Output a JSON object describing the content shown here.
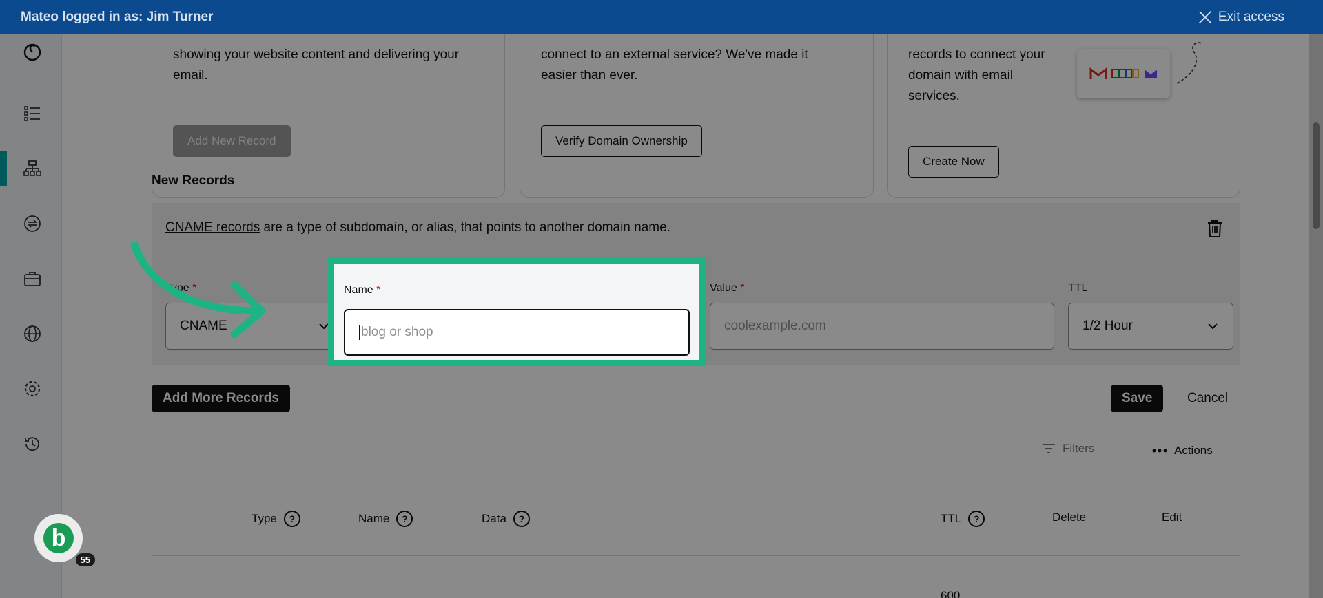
{
  "topbar": {
    "logged_in_text": "Mateo logged in as: Jim Turner",
    "exit_label": "Exit access"
  },
  "cards": [
    {
      "text": "showing your website content and delivering your email.",
      "button": "Add New Record"
    },
    {
      "text": "connect to an external service? We've made it easier than ever.",
      "button": "Verify Domain Ownership"
    },
    {
      "text": "records to connect your domain with email services.",
      "button": "Create Now"
    }
  ],
  "new_records": {
    "title": "New Records",
    "desc_link": "CNAME records",
    "desc_rest": " are a type of subdomain, or alias, that points to another domain name.",
    "type_label": "Type",
    "type_value": "CNAME",
    "name_label": "Name",
    "name_placeholder": "blog or shop",
    "value_label": "Value",
    "value_placeholder": "coolexample.com",
    "ttl_label": "TTL",
    "ttl_value": "1/2 Hour",
    "required_mark": "*"
  },
  "actions": {
    "add_more": "Add More Records",
    "save": "Save",
    "cancel": "Cancel"
  },
  "table": {
    "filters": "Filters",
    "actions": "Actions",
    "headers": [
      "Type",
      "Name",
      "Data",
      "TTL",
      "Delete",
      "Edit"
    ],
    "help_mark": "?",
    "first_row_ttl": "600"
  },
  "extension_badge": {
    "letter": "b",
    "count": "55"
  },
  "colors": {
    "topbar": "#0b4a8f",
    "highlight": "#1db384",
    "active_nav": "#00a4a6"
  }
}
